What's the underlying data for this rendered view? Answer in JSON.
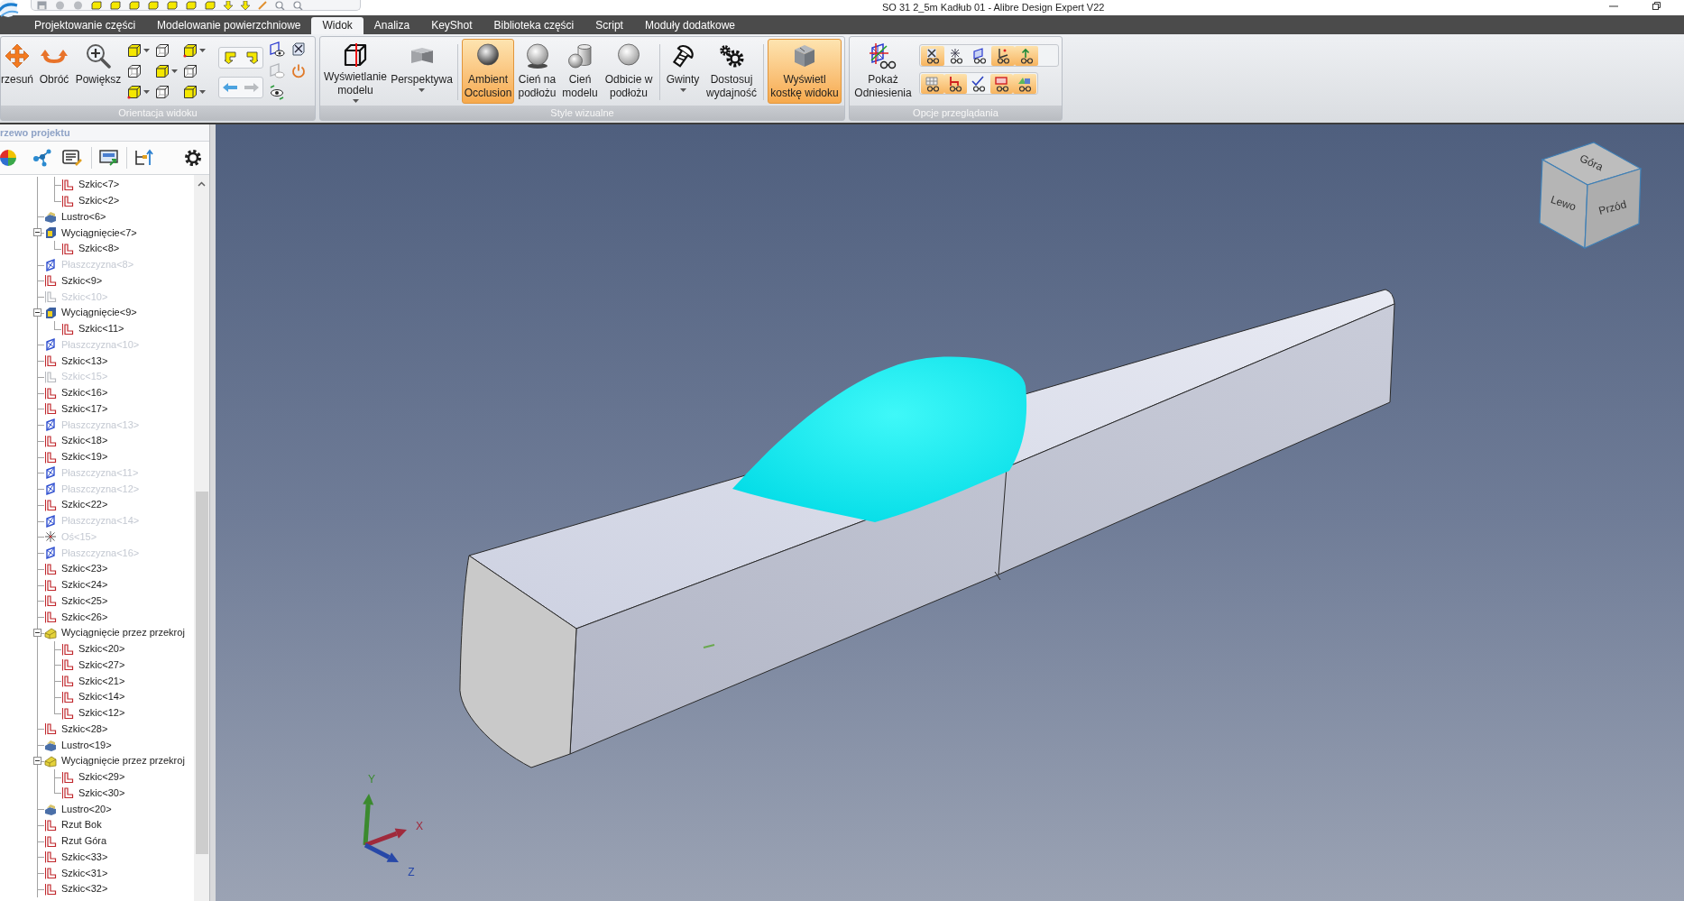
{
  "window": {
    "title": "SO 31 2_5m Kadłub 01 - Alibre Design Expert V22"
  },
  "tabs": [
    {
      "label": "Projektowanie części",
      "selected": false
    },
    {
      "label": "Modelowanie powierzchniowe",
      "selected": false
    },
    {
      "label": "Widok",
      "selected": true
    },
    {
      "label": "Analiza",
      "selected": false
    },
    {
      "label": "KeyShot",
      "selected": false
    },
    {
      "label": "Biblioteka części",
      "selected": false
    },
    {
      "label": "Script",
      "selected": false
    },
    {
      "label": "Moduły dodatkowe",
      "selected": false
    }
  ],
  "ribbon": {
    "groups": [
      {
        "kind": "orientation",
        "label": "Orientacja widoku",
        "sections": [
          [
            {
              "kind": "pan",
              "label": "rzesuń",
              "menu": false,
              "selected": false
            },
            {
              "kind": "rotate",
              "label": "Obróć",
              "menu": false,
              "selected": false
            },
            {
              "kind": "zoom",
              "label": "Powiększ",
              "menu": false,
              "selected": false
            }
          ]
        ]
      },
      {
        "kind": "styles",
        "label": "Style wizualne",
        "sections": [
          [
            {
              "kind": "display",
              "label": "Wyświetlanie modelu",
              "menu": true,
              "selected": false
            },
            {
              "kind": "perspective",
              "label": "Perspektywa",
              "menu": true,
              "selected": false
            }
          ],
          [
            {
              "kind": "occlusion",
              "label": "Ambient Occlusion",
              "menu": false,
              "selected": true
            },
            {
              "kind": "floorshadow",
              "label": "Cień na podłożu",
              "menu": false,
              "selected": false
            },
            {
              "kind": "modelshadow",
              "label": "Cień modelu",
              "menu": false,
              "selected": false
            },
            {
              "kind": "reflection",
              "label": "Odbicie w podłożu",
              "menu": false,
              "selected": false
            }
          ],
          [
            {
              "kind": "threads",
              "label": "Gwinty",
              "menu": true,
              "selected": false
            },
            {
              "kind": "performance",
              "label": "Dostosuj wydajność",
              "menu": false,
              "selected": false
            }
          ],
          [
            {
              "kind": "viewcube",
              "label": "Wyświetl kostkę widoku",
              "menu": false,
              "selected": true
            }
          ]
        ]
      },
      {
        "kind": "browse",
        "label": "Opcje przeglądania",
        "sections": [
          [
            {
              "kind": "references",
              "label": "Pokaż Odniesienia",
              "menu": false,
              "selected": false
            }
          ]
        ],
        "toggles": [
          [
            {
              "kind": "cross",
              "on": true
            },
            {
              "kind": "asterisk",
              "on": false
            },
            {
              "kind": "plane",
              "on": false
            },
            {
              "kind": "axes",
              "on": true
            },
            {
              "kind": "arrow",
              "on": true
            }
          ],
          [
            {
              "kind": "grid",
              "on": true
            },
            {
              "kind": "chair",
              "on": true
            },
            {
              "kind": "check",
              "on": false
            },
            {
              "kind": "frame",
              "on": true
            },
            {
              "kind": "mix",
              "on": true
            }
          ]
        ]
      }
    ]
  },
  "project_panel": {
    "title": "rzewo projektu",
    "tree": {
      "leading_children": [
        {
          "label": "Szkic<7>",
          "kind": "sketch",
          "hidden": false
        },
        {
          "label": "Szkic<2>",
          "kind": "sketch",
          "hidden": false
        }
      ],
      "items": [
        {
          "label": "Lustro<6>",
          "kind": "mirror",
          "hidden": false,
          "expanded": false
        },
        {
          "label": "Wyciągnięcie<7>",
          "kind": "extrude",
          "hidden": false,
          "expanded": true,
          "children": [
            {
              "label": "Szkic<8>",
              "kind": "sketch",
              "hidden": false
            }
          ]
        },
        {
          "label": "Płaszczyzna<8>",
          "kind": "plane",
          "hidden": true,
          "expanded": false
        },
        {
          "label": "Szkic<9>",
          "kind": "sketch",
          "hidden": false,
          "expanded": false
        },
        {
          "label": "Szkic<10>",
          "kind": "sketch",
          "hidden": true,
          "expanded": false
        },
        {
          "label": "Wyciągnięcie<9>",
          "kind": "extrude",
          "hidden": false,
          "expanded": true,
          "children": [
            {
              "label": "Szkic<11>",
              "kind": "sketch",
              "hidden": false
            }
          ]
        },
        {
          "label": "Płaszczyzna<10>",
          "kind": "plane",
          "hidden": true,
          "expanded": false
        },
        {
          "label": "Szkic<13>",
          "kind": "sketch",
          "hidden": false,
          "expanded": false
        },
        {
          "label": "Szkic<15>",
          "kind": "sketch",
          "hidden": true,
          "expanded": false
        },
        {
          "label": "Szkic<16>",
          "kind": "sketch",
          "hidden": false,
          "expanded": false
        },
        {
          "label": "Szkic<17>",
          "kind": "sketch",
          "hidden": false,
          "expanded": false
        },
        {
          "label": "Płaszczyzna<13>",
          "kind": "plane",
          "hidden": true,
          "expanded": false
        },
        {
          "label": "Szkic<18>",
          "kind": "sketch",
          "hidden": false,
          "expanded": false
        },
        {
          "label": "Szkic<19>",
          "kind": "sketch",
          "hidden": false,
          "expanded": false
        },
        {
          "label": "Płaszczyzna<11>",
          "kind": "plane",
          "hidden": true,
          "expanded": false
        },
        {
          "label": "Płaszczyzna<12>",
          "kind": "plane",
          "hidden": true,
          "expanded": false
        },
        {
          "label": "Szkic<22>",
          "kind": "sketch",
          "hidden": false,
          "expanded": false
        },
        {
          "label": "Płaszczyzna<14>",
          "kind": "plane",
          "hidden": true,
          "expanded": false
        },
        {
          "label": "Oś<15>",
          "kind": "axis",
          "hidden": true,
          "expanded": false
        },
        {
          "label": "Płaszczyzna<16>",
          "kind": "plane",
          "hidden": true,
          "expanded": false
        },
        {
          "label": "Szkic<23>",
          "kind": "sketch",
          "hidden": false,
          "expanded": false
        },
        {
          "label": "Szkic<24>",
          "kind": "sketch",
          "hidden": false,
          "expanded": false
        },
        {
          "label": "Szkic<25>",
          "kind": "sketch",
          "hidden": false,
          "expanded": false
        },
        {
          "label": "Szkic<26>",
          "kind": "sketch",
          "hidden": false,
          "expanded": false
        },
        {
          "label": "Wyciągnięcie przez przekroj",
          "kind": "loft",
          "hidden": false,
          "expanded": true,
          "children": [
            {
              "label": "Szkic<20>",
              "kind": "sketch",
              "hidden": false
            },
            {
              "label": "Szkic<27>",
              "kind": "sketch",
              "hidden": false
            },
            {
              "label": "Szkic<21>",
              "kind": "sketch",
              "hidden": false
            },
            {
              "label": "Szkic<14>",
              "kind": "sketch",
              "hidden": false
            },
            {
              "label": "Szkic<12>",
              "kind": "sketch",
              "hidden": false
            }
          ]
        },
        {
          "label": "Szkic<28>",
          "kind": "sketch",
          "hidden": false,
          "expanded": false
        },
        {
          "label": "Lustro<19>",
          "kind": "mirror",
          "hidden": false,
          "expanded": false
        },
        {
          "label": "Wyciągnięcie przez przekroj",
          "kind": "loft",
          "hidden": false,
          "expanded": true,
          "children": [
            {
              "label": "Szkic<29>",
              "kind": "sketch",
              "hidden": false
            },
            {
              "label": "Szkic<30>",
              "kind": "sketch",
              "hidden": false
            }
          ]
        },
        {
          "label": "Lustro<20>",
          "kind": "mirror",
          "hidden": false,
          "expanded": false
        },
        {
          "label": "Rzut Bok",
          "kind": "sketch",
          "hidden": false,
          "expanded": false
        },
        {
          "label": "Rzut Góra",
          "kind": "sketch",
          "hidden": false,
          "expanded": false
        },
        {
          "label": "Szkic<33>",
          "kind": "sketch",
          "hidden": false,
          "expanded": false
        },
        {
          "label": "Szkic<31>",
          "kind": "sketch",
          "hidden": false,
          "expanded": false
        },
        {
          "label": "Szkic<32>",
          "kind": "sketch",
          "hidden": false,
          "expanded": false
        }
      ]
    }
  },
  "viewport": {
    "view_cube": {
      "faces": [
        "Góra",
        "Lewo",
        "Przód"
      ]
    },
    "axes": [
      {
        "label": "Y",
        "color": "#3b8a2e"
      },
      {
        "label": "X",
        "color": "#a02a3c"
      },
      {
        "label": "Z",
        "color": "#2748a8"
      }
    ]
  }
}
